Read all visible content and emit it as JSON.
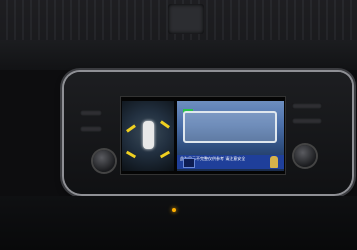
{
  "screen": {
    "caption": "此为显示不完整仅供参考 请注意安全",
    "accent_colors": {
      "guideline": "#f0d020",
      "marker": "#29c24a",
      "caption_bar": "#1f3f9a"
    }
  },
  "icons": {
    "person": "person-icon",
    "mode": "camera-mode-icon"
  }
}
